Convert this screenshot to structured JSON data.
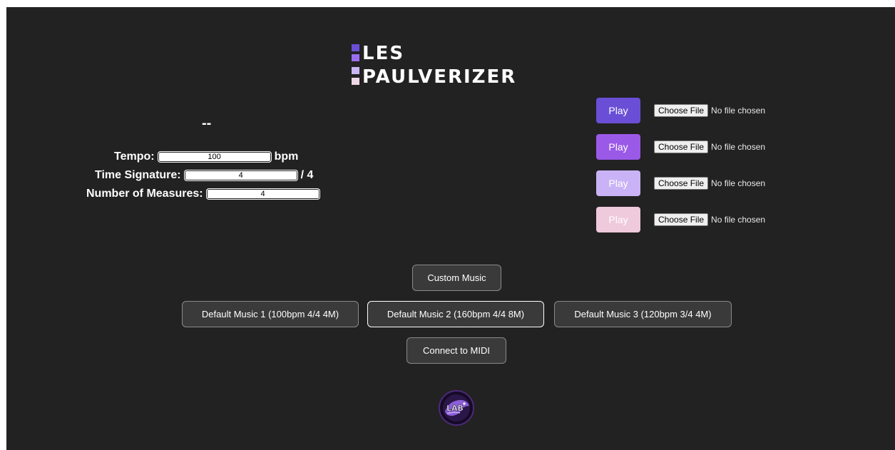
{
  "logo": {
    "line1": "LES",
    "line2": "PAULVERIZER",
    "bar_colors": [
      "#6a4fd6",
      "#9b6ef0",
      "#c9b6f5",
      "#efd8e6"
    ]
  },
  "status": "--",
  "settings": {
    "tempo_label": "Tempo:",
    "tempo_value": "100",
    "tempo_unit": "bpm",
    "time_signature_label": "Time Signature:",
    "time_signature_value": "4",
    "time_signature_unit": "/ 4",
    "measures_label": "Number of Measures:",
    "measures_value": "4"
  },
  "tracks": [
    {
      "play_label": "Play",
      "color": "#6a4fd6",
      "choose_label": "Choose File",
      "file_status": "No file chosen"
    },
    {
      "play_label": "Play",
      "color": "#9b59e8",
      "choose_label": "Choose File",
      "file_status": "No file chosen"
    },
    {
      "play_label": "Play",
      "color": "#c9b3f6",
      "choose_label": "Choose File",
      "file_status": "No file chosen"
    },
    {
      "play_label": "Play",
      "color": "#efc9dc",
      "choose_label": "Choose File",
      "file_status": "No file chosen"
    }
  ],
  "music_buttons": {
    "custom": "Custom Music",
    "default1": "Default Music 1 (100bpm 4/4 4M)",
    "default2": "Default Music 2 (160bpm 4/4 8M)",
    "default3": "Default Music 3 (120bpm 3/4 4M)",
    "midi": "Connect to MIDI"
  },
  "badge": {
    "text": "LAB",
    "icon": "lab-logo-icon"
  }
}
